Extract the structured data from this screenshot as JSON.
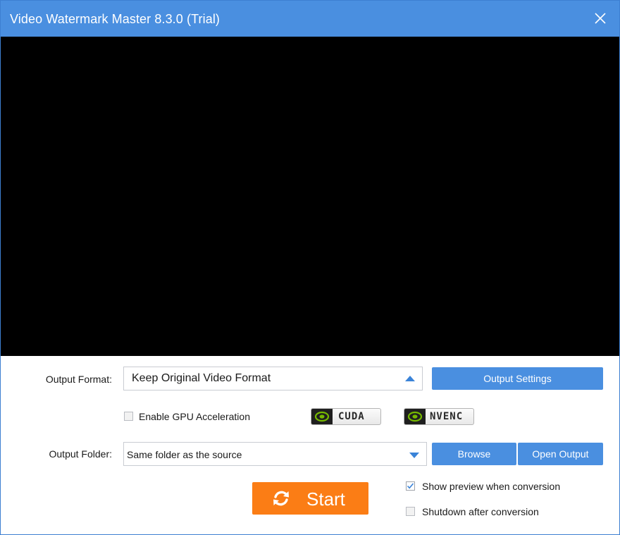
{
  "window": {
    "title": "Video Watermark Master 8.3.0 (Trial)"
  },
  "output_format": {
    "label": "Output Format:",
    "value": "Keep Original Video Format",
    "settings_button": "Output Settings"
  },
  "gpu": {
    "label": "Enable GPU Acceleration",
    "checked": false,
    "badges": [
      "CUDA",
      "NVENC"
    ]
  },
  "output_folder": {
    "label": "Output Folder:",
    "value": "Same folder as the source",
    "browse_button": "Browse",
    "open_button": "Open Output"
  },
  "start_button": "Start",
  "options": {
    "show_preview": {
      "label": "Show preview when conversion",
      "checked": true
    },
    "shutdown": {
      "label": "Shutdown after conversion",
      "checked": false
    }
  },
  "colors": {
    "titlebar": "#4a8fe0",
    "accent_button": "#4a8fe0",
    "start_button": "#fb7d15",
    "preview_background": "#000000"
  }
}
